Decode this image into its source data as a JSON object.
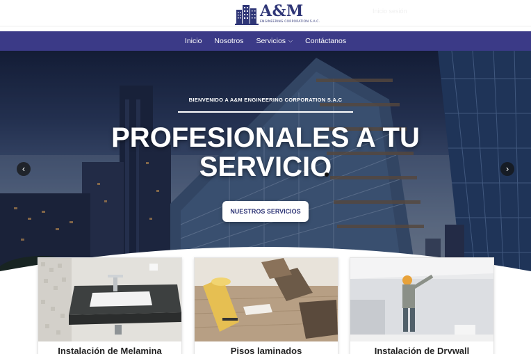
{
  "brand": {
    "name": "A&M",
    "subtitle": "ENGINEERING CORPORATION S.A.C.",
    "top_link": "Inicio sesión"
  },
  "nav": {
    "items": [
      {
        "label": "Inicio"
      },
      {
        "label": "Nosotros"
      },
      {
        "label": "Servicios",
        "has_dropdown": true
      },
      {
        "label": "Contáctanos"
      }
    ],
    "background": "#3b3a87"
  },
  "hero": {
    "kicker": "BIENVENIDO A A&M ENGINEERING CORPORATION S.A.C",
    "title_line1": "PROFESIONALES A TU",
    "title_line2": "SERVICIO",
    "button_label": "NUESTROS SERVICIOS",
    "prev_icon": "chevron-left-icon",
    "next_icon": "chevron-right-icon"
  },
  "cards": [
    {
      "title": "Instalación de Melamina",
      "image": "bathroom-vanity"
    },
    {
      "title": "Pisos laminados",
      "image": "laminate-floor-rolls"
    },
    {
      "title": "Instalación de Drywall",
      "image": "worker-painting-ceiling"
    }
  ]
}
